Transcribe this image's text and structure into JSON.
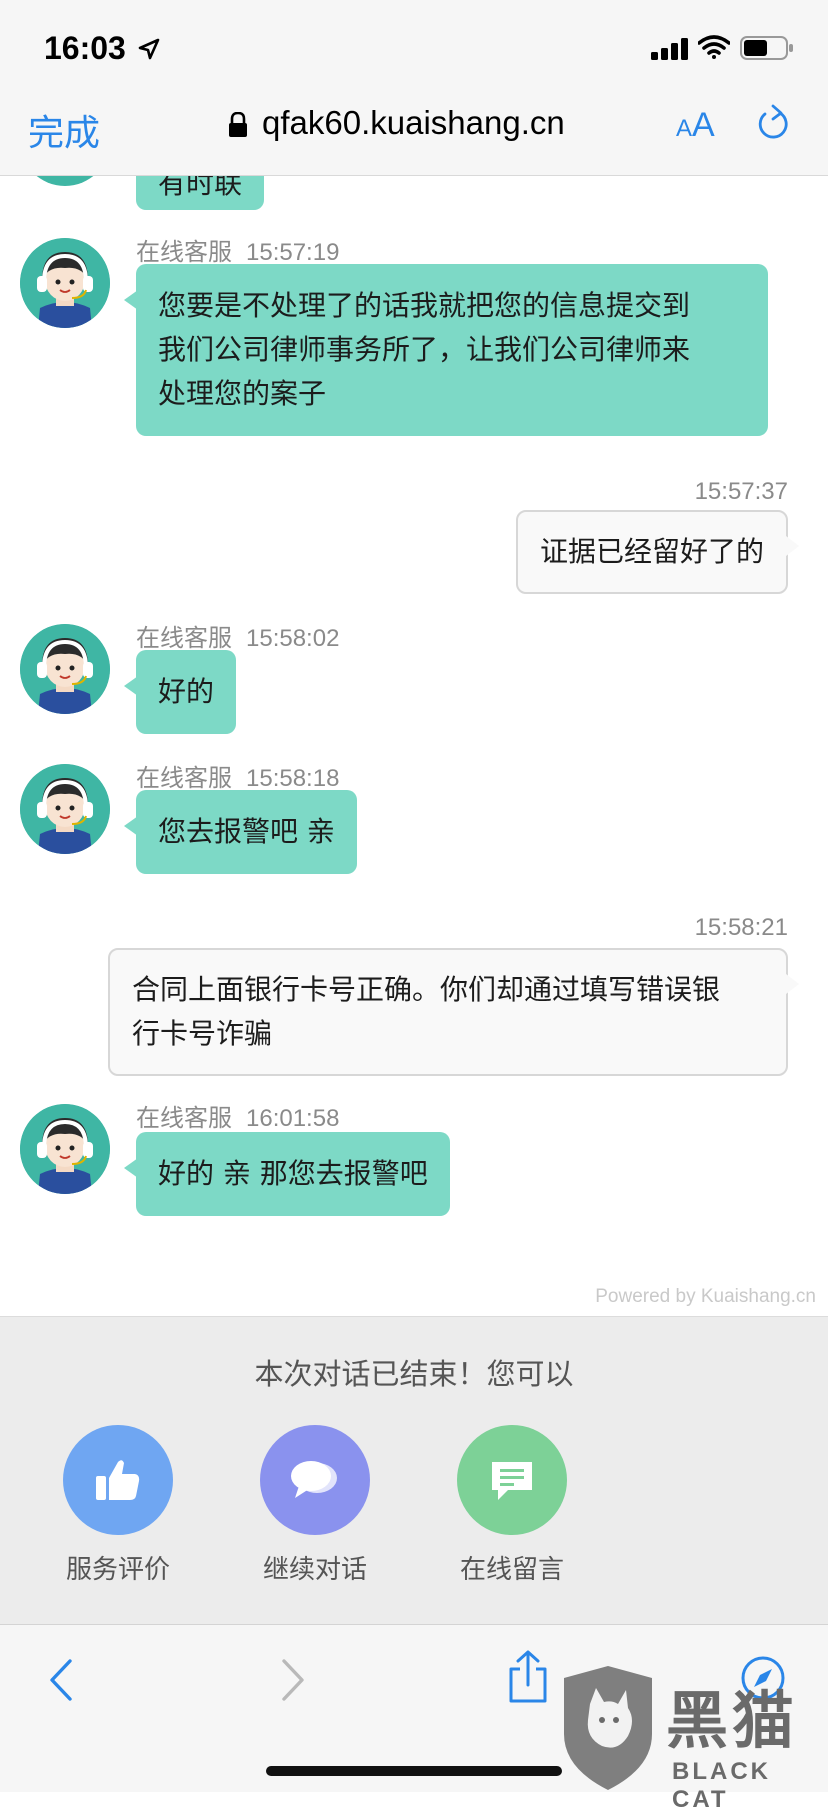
{
  "status_bar": {
    "time": "16:03"
  },
  "browser": {
    "done_label": "完成",
    "url": "qfak60.kuaishang.cn",
    "text_size_small": "A",
    "text_size_large": "A"
  },
  "chat": {
    "partial_top_text": "有时联",
    "messages": [
      {
        "from": "agent",
        "name": "在线客服",
        "time": "15:57:19",
        "lines": [
          "您要是不处理了的话我就把您的信息提交到",
          "我们公司律师事务所了，让我们公司律师来",
          "处理您的案子"
        ]
      },
      {
        "from": "user",
        "time": "15:57:37",
        "lines": [
          "证据已经留好了的"
        ]
      },
      {
        "from": "agent",
        "name": "在线客服",
        "time": "15:58:02",
        "lines": [
          "好的"
        ]
      },
      {
        "from": "agent",
        "name": "在线客服",
        "time": "15:58:18",
        "lines": [
          "您去报警吧 亲"
        ]
      },
      {
        "from": "user",
        "time": "15:58:21",
        "lines": [
          "合同上面银行卡号正确。你们却通过填写错误银",
          "行卡号诈骗"
        ]
      },
      {
        "from": "agent",
        "name": "在线客服",
        "time": "16:01:58",
        "lines": [
          "好的 亲 那您去报警吧"
        ]
      }
    ],
    "powered_by": "Powered by Kuaishang.cn"
  },
  "ended_panel": {
    "message": "本次对话已结束！您可以",
    "actions": [
      {
        "label": "服务评价",
        "icon": "thumbs-up-icon",
        "color": "#6fa6f2"
      },
      {
        "label": "继续对话",
        "icon": "chat-bubbles-icon",
        "color": "#8a92ee"
      },
      {
        "label": "在线留言",
        "icon": "message-icon",
        "color": "#7dd197"
      }
    ]
  },
  "watermark": {
    "text": "黑猫",
    "sub": "BLACK CAT"
  },
  "colors": {
    "accent": "#2a86e8",
    "agent_bubble": "#7dd9c6",
    "user_bubble": "#f9f9f9"
  }
}
